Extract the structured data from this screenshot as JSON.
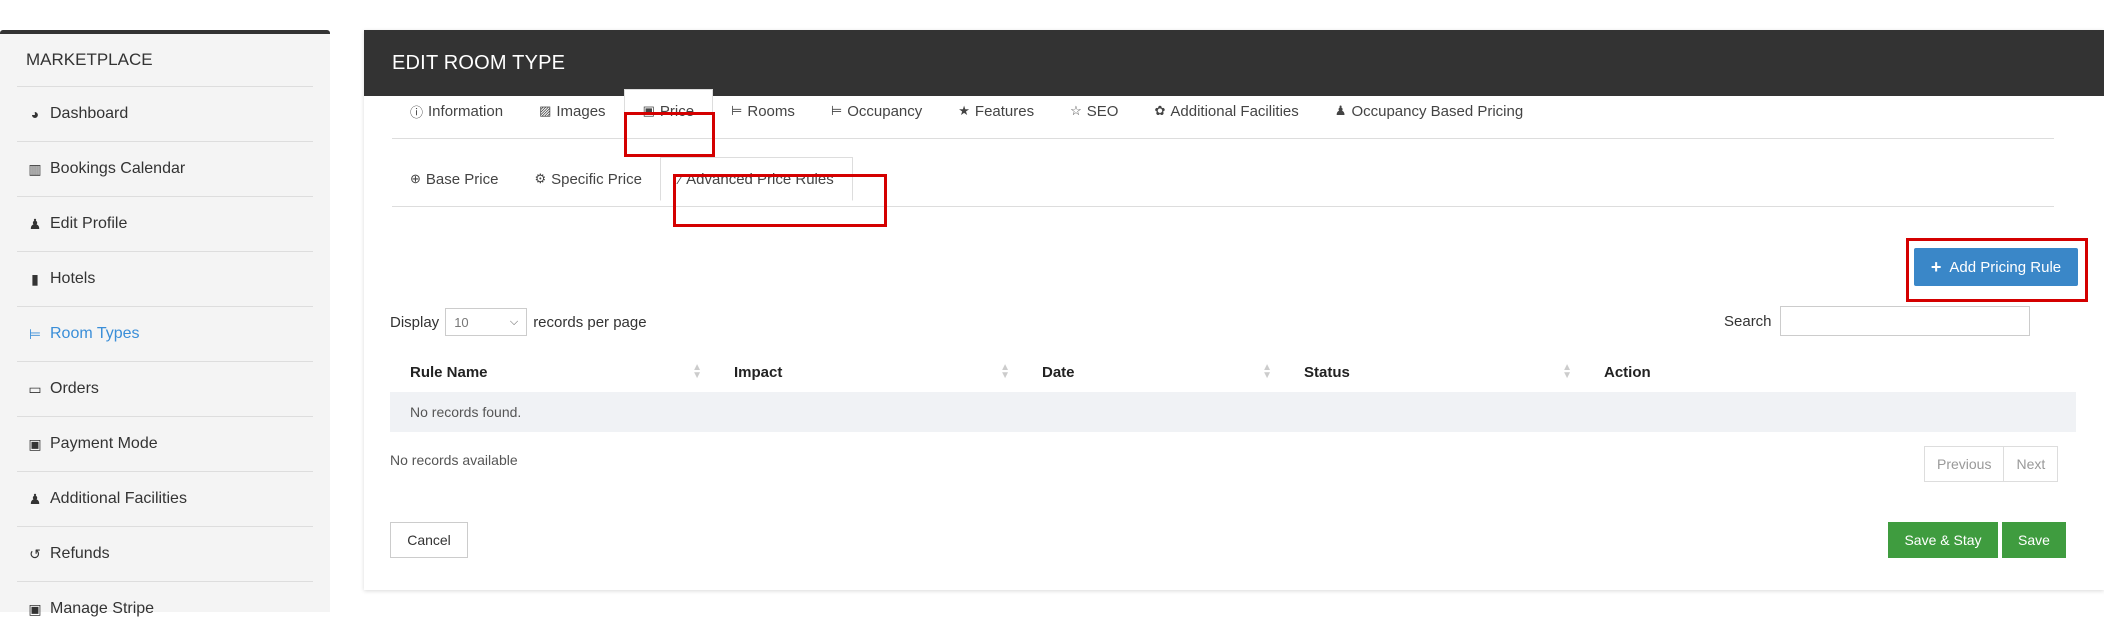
{
  "sidebar": {
    "title": "MARKETPLACE",
    "items": [
      {
        "label": "Dashboard",
        "icon": "dashboard-icon",
        "glyph": "◕"
      },
      {
        "label": "Bookings Calendar",
        "icon": "chart-icon",
        "glyph": "▥"
      },
      {
        "label": "Edit Profile",
        "icon": "user-icon",
        "glyph": "♟"
      },
      {
        "label": "Hotels",
        "icon": "building-icon",
        "glyph": "▮"
      },
      {
        "label": "Room Types",
        "icon": "bed-icon",
        "glyph": "⊨",
        "active": true
      },
      {
        "label": "Orders",
        "icon": "card-icon",
        "glyph": "▭"
      },
      {
        "label": "Payment Mode",
        "icon": "money-icon",
        "glyph": "▣"
      },
      {
        "label": "Additional Facilities",
        "icon": "user-plus-icon",
        "glyph": "♟"
      },
      {
        "label": "Refunds",
        "icon": "undo-icon",
        "glyph": "↺"
      },
      {
        "label": "Manage Stripe",
        "icon": "money-icon",
        "glyph": "▣"
      }
    ]
  },
  "panel": {
    "title": "EDIT ROOM TYPE",
    "main_tabs": [
      {
        "label": "Information",
        "glyph": "ⓘ"
      },
      {
        "label": "Images",
        "glyph": "▨"
      },
      {
        "label": "Price",
        "glyph": "▣",
        "active": true
      },
      {
        "label": "Rooms",
        "glyph": "⊨"
      },
      {
        "label": "Occupancy",
        "glyph": "⊨"
      },
      {
        "label": "Features",
        "glyph": "★"
      },
      {
        "label": "SEO",
        "glyph": "☆"
      },
      {
        "label": "Additional Facilities",
        "glyph": "✿"
      },
      {
        "label": "Occupancy Based Pricing",
        "glyph": "♟"
      }
    ],
    "price_tabs": [
      {
        "label": "Base Price",
        "glyph": "⊕"
      },
      {
        "label": "Specific Price",
        "glyph": "⚙"
      },
      {
        "label": "Advanced Price Rules",
        "glyph": "⁄",
        "active": true
      }
    ],
    "add_rule_label": "Add Pricing Rule",
    "display_label": "Display",
    "page_size": "10",
    "records_per_page": "records per page",
    "search_label": "Search",
    "search_value": "",
    "columns": [
      "Rule Name",
      "Impact",
      "Date",
      "Status",
      "Action"
    ],
    "empty_row": "No records found.",
    "no_records": "No records available",
    "pager": {
      "previous": "Previous",
      "next": "Next"
    },
    "cancel_label": "Cancel",
    "save_stay_label": "Save & Stay",
    "save_label": "Save"
  },
  "colors": {
    "header_bg": "#333333",
    "primary": "#3a87c8",
    "success": "#3f9c3f",
    "highlight": "#d40000",
    "active_sidebar": "#3a8ed8"
  }
}
